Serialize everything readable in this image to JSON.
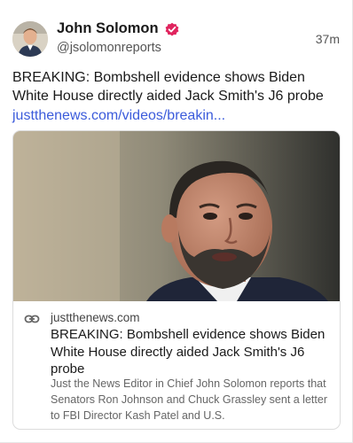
{
  "post": {
    "author": {
      "name": "John Solomon",
      "handle": "@jsolomonreports",
      "avatar_icon": "person-avatar",
      "verified_icon": "verified-badge-icon",
      "verified_color": "#e0245e"
    },
    "time": "37m",
    "text": "BREAKING: Bombshell evidence shows Biden White House directly aided Jack Smith's J6 probe",
    "link": "justthenews.com/videos/breakin...",
    "link_color": "#3b5bdb"
  },
  "card": {
    "image_icon": "news-photo",
    "link_icon": "link-icon",
    "domain": "justthenews.com",
    "title": "BREAKING: Bombshell evidence shows Biden White House directly aided Jack Smith's J6 probe",
    "description": "Just the News Editor in Chief John Solomon reports that Senators Ron Johnson and Chuck Grassley sent a letter to FBI Director Kash Patel and U.S."
  }
}
